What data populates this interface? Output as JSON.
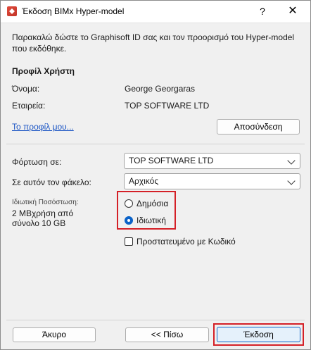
{
  "window": {
    "title": "Έκδοση BIMx Hyper-model",
    "help_label": "?",
    "close_label": "✕"
  },
  "intro": "Παρακαλώ δώστε το Graphisoft ID σας και τον προορισμό του Hyper-model που εκδόθηκε.",
  "profile": {
    "section_title": "Προφίλ Χρήστη",
    "name_label": "Όνομα:",
    "name_value": "George Georgaras",
    "company_label": "Εταιρεία:",
    "company_value": "TOP SOFTWARE LTD",
    "my_profile_link": "Το προφίλ μου...",
    "logout_button": "Αποσύνδεση"
  },
  "upload": {
    "upload_to_label": "Φόρτωση σε:",
    "upload_to_value": "TOP SOFTWARE LTD",
    "folder_label": "Σε αυτόν τον φάκελο:",
    "folder_value": "Αρχικός",
    "quota_label": "Ιδιωτική Ποσόστωση:",
    "quota_value": "2 MBχρήση από σύνολο 10 GB"
  },
  "visibility": {
    "public_label": "Δημόσια",
    "private_label": "Ιδιωτική",
    "selected": "private",
    "password_label": "Προστατευμένο με Κωδικό",
    "password_checked": false
  },
  "footer": {
    "cancel_button": "Άκυρο",
    "back_button": "<< Πίσω",
    "publish_button": "Έκδοση"
  },
  "colors": {
    "highlight": "#d42027",
    "accent": "#0a62c8",
    "link": "#1a54c4"
  }
}
